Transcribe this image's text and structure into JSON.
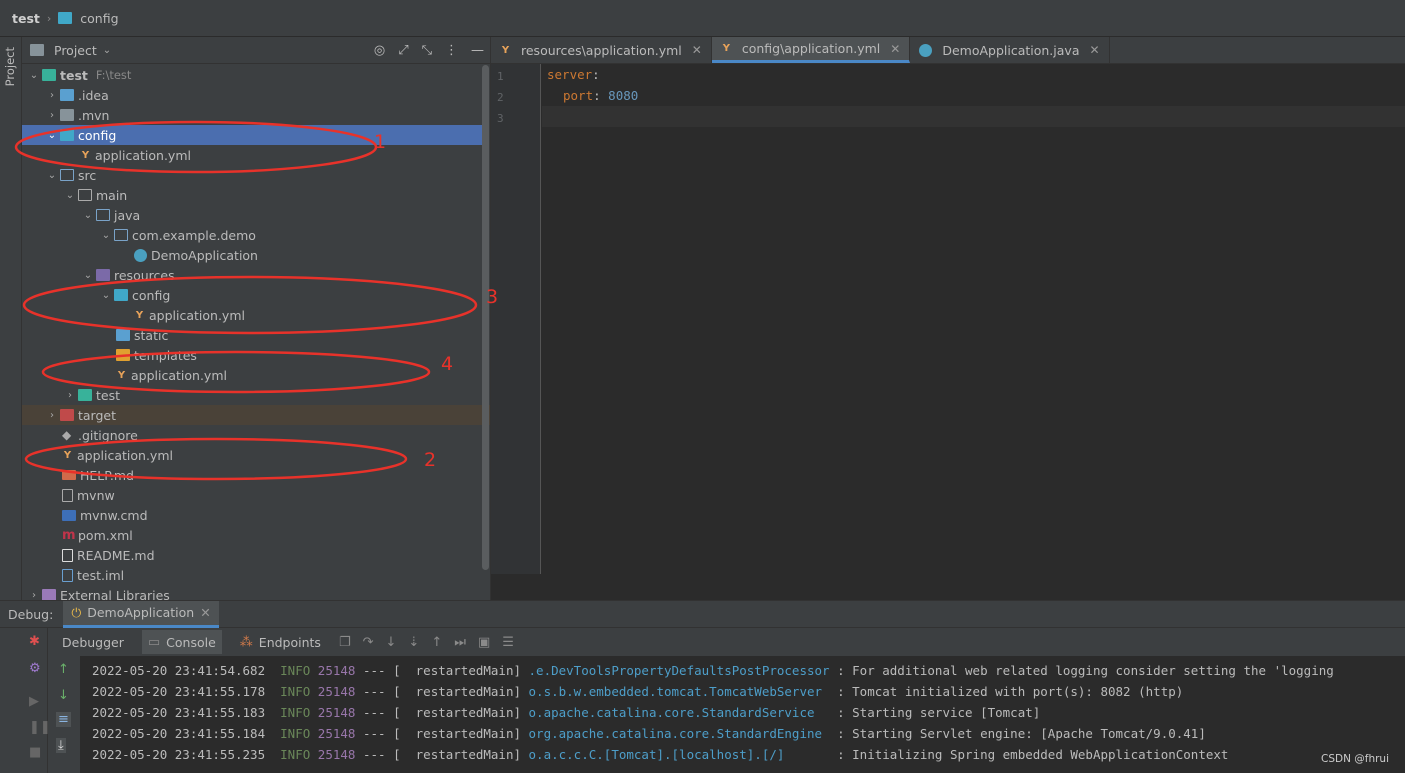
{
  "breadcrumb": {
    "project": "test",
    "folder": "config"
  },
  "stripe": {
    "label": "Project"
  },
  "project_panel": {
    "title": "Project",
    "tree": [
      {
        "label": "test",
        "sub": "F:\\test"
      },
      {
        "label": ".idea"
      },
      {
        "label": ".mvn"
      },
      {
        "label": "config"
      },
      {
        "label": "application.yml"
      },
      {
        "label": "src"
      },
      {
        "label": "main"
      },
      {
        "label": "java"
      },
      {
        "label": "com.example.demo"
      },
      {
        "label": "DemoApplication"
      },
      {
        "label": "resources"
      },
      {
        "label": "config"
      },
      {
        "label": "application.yml"
      },
      {
        "label": "static"
      },
      {
        "label": "templates"
      },
      {
        "label": "application.yml"
      },
      {
        "label": "test"
      },
      {
        "label": "target"
      },
      {
        "label": ".gitignore"
      },
      {
        "label": "application.yml"
      },
      {
        "label": "HELP.md"
      },
      {
        "label": "mvnw"
      },
      {
        "label": "mvnw.cmd"
      },
      {
        "label": "pom.xml"
      },
      {
        "label": "README.md"
      },
      {
        "label": "test.iml"
      },
      {
        "label": "External Libraries"
      }
    ]
  },
  "editor": {
    "tabs": [
      {
        "label": "resources\\application.yml"
      },
      {
        "label": "config\\application.yml"
      },
      {
        "label": "DemoApplication.java"
      }
    ],
    "lines": [
      {
        "n": "1",
        "key": "server",
        "colon": ":",
        "val": ""
      },
      {
        "n": "2",
        "key": "port",
        "colon": ": ",
        "val": "8080"
      },
      {
        "n": "3",
        "key": "",
        "colon": "",
        "val": ""
      }
    ]
  },
  "debug": {
    "label": "Debug:",
    "run_config": "DemoApplication",
    "tools": {
      "debugger": "Debugger",
      "console": "Console",
      "endpoints": "Endpoints"
    },
    "logs": [
      {
        "ts": "2022-05-20 23:41:54.682",
        "level": "INFO",
        "pid": "25148",
        "sep": " --- [  restartedMain] ",
        "cls": ".e.DevToolsPropertyDefaultsPostProcessor",
        "msg": " : For additional web related logging consider setting the 'logging"
      },
      {
        "ts": "2022-05-20 23:41:55.178",
        "level": "INFO",
        "pid": "25148",
        "sep": " --- [  restartedMain] ",
        "cls": "o.s.b.w.embedded.tomcat.TomcatWebServer ",
        "msg": " : Tomcat initialized with port(s): 8082 (http)"
      },
      {
        "ts": "2022-05-20 23:41:55.183",
        "level": "INFO",
        "pid": "25148",
        "sep": " --- [  restartedMain] ",
        "cls": "o.apache.catalina.core.StandardService  ",
        "msg": " : Starting service [Tomcat]"
      },
      {
        "ts": "2022-05-20 23:41:55.184",
        "level": "INFO",
        "pid": "25148",
        "sep": " --- [  restartedMain] ",
        "cls": "org.apache.catalina.core.StandardEngine ",
        "msg": " : Starting Servlet engine: [Apache Tomcat/9.0.41]"
      },
      {
        "ts": "2022-05-20 23:41:55.235",
        "level": "INFO",
        "pid": "25148",
        "sep": " --- [  restartedMain] ",
        "cls": "o.a.c.c.C.[Tomcat].[localhost].[/]      ",
        "msg": " : Initializing Spring embedded WebApplicationContext"
      }
    ]
  },
  "watermark": "CSDN @fhrui",
  "annotations": [
    "1",
    "2",
    "3",
    "4"
  ],
  "colors": {
    "annotation": "#e8322a",
    "selection": "#4b6eaf",
    "accent": "#4a88c7"
  }
}
